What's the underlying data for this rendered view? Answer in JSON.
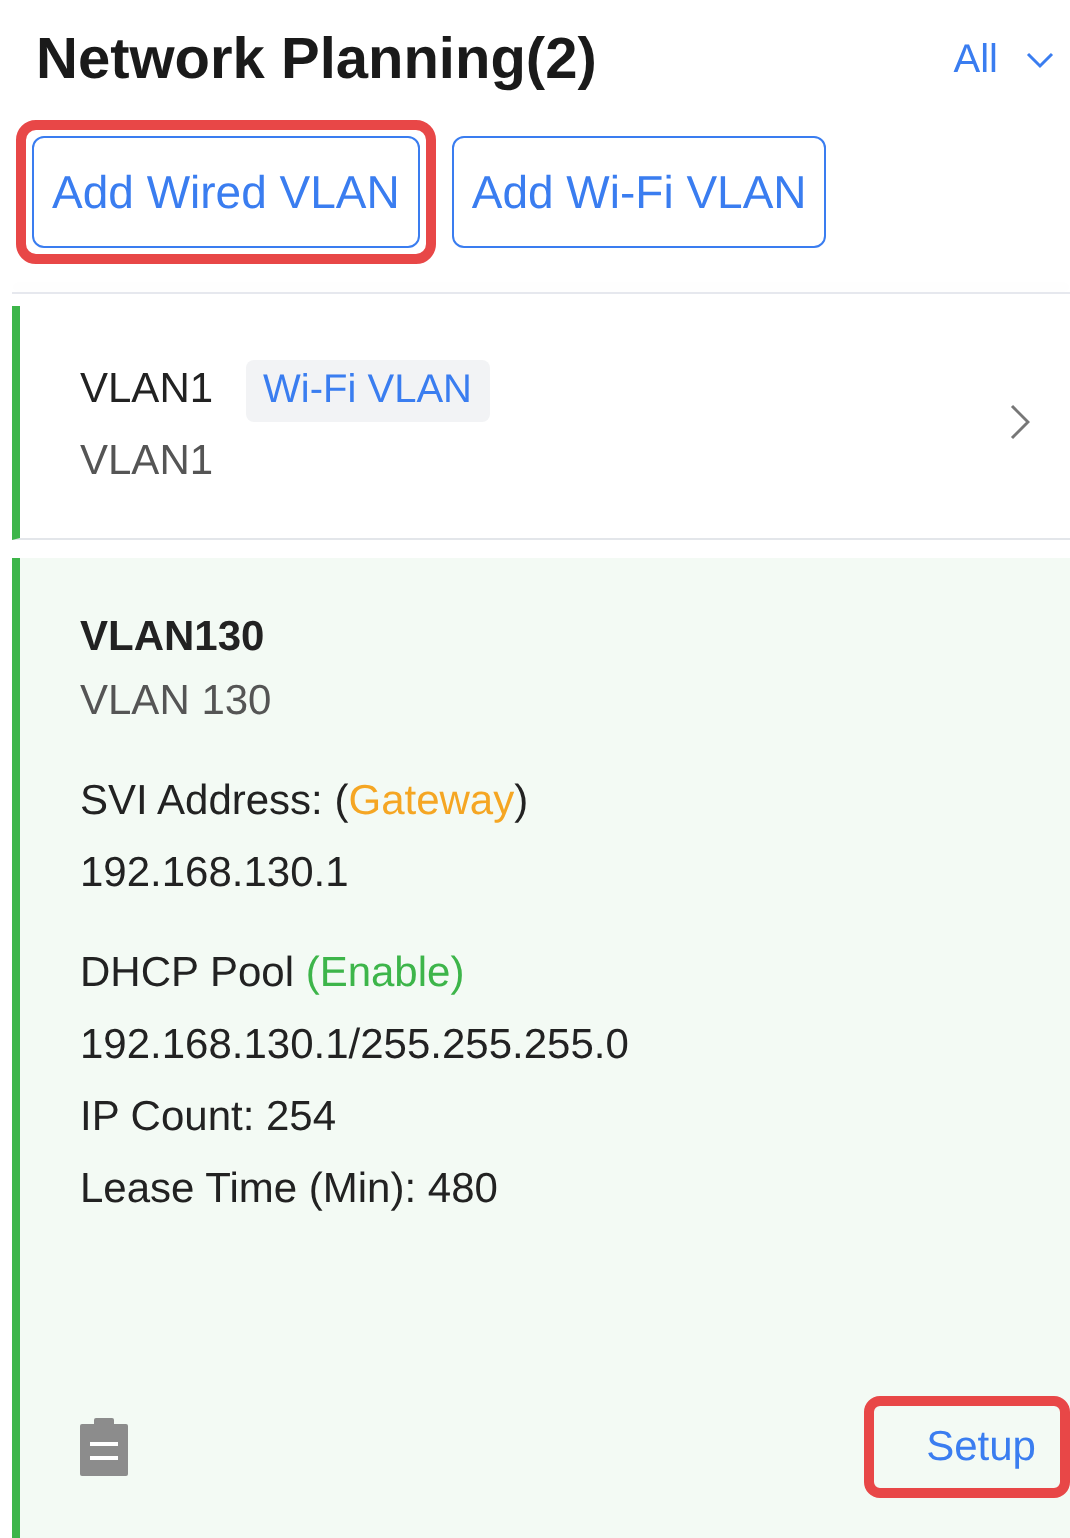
{
  "header": {
    "title": "Network Planning(2)",
    "filter": "All"
  },
  "buttons": [
    {
      "label": "Add Wired VLAN",
      "highlighted": true
    },
    {
      "label": "Add Wi-Fi VLAN",
      "highlighted": false
    }
  ],
  "vlans": [
    {
      "name": "VLAN1",
      "tag": "Wi-Fi VLAN",
      "subtitle": "VLAN1",
      "expanded": false
    },
    {
      "name": "VLAN130",
      "subtitle": "VLAN 130",
      "expanded": true,
      "groups": [
        {
          "lines": [
            {
              "kind": "status",
              "label": "SVI Address: (",
              "status": "Gateway",
              "suffix": ")",
              "color": "#f5a623"
            },
            {
              "kind": "plain",
              "text": "192.168.130.1"
            }
          ]
        },
        {
          "lines": [
            {
              "kind": "status",
              "label": "DHCP Pool ",
              "status": "(Enable)",
              "color": "#3db54a"
            },
            {
              "kind": "plain",
              "text": "192.168.130.1/255.255.255.0"
            },
            {
              "kind": "plain",
              "text": "IP Count: 254"
            },
            {
              "kind": "plain",
              "text": "Lease Time (Min): 480"
            }
          ]
        }
      ],
      "action": {
        "label": "Setup",
        "highlighted": true
      }
    }
  ]
}
